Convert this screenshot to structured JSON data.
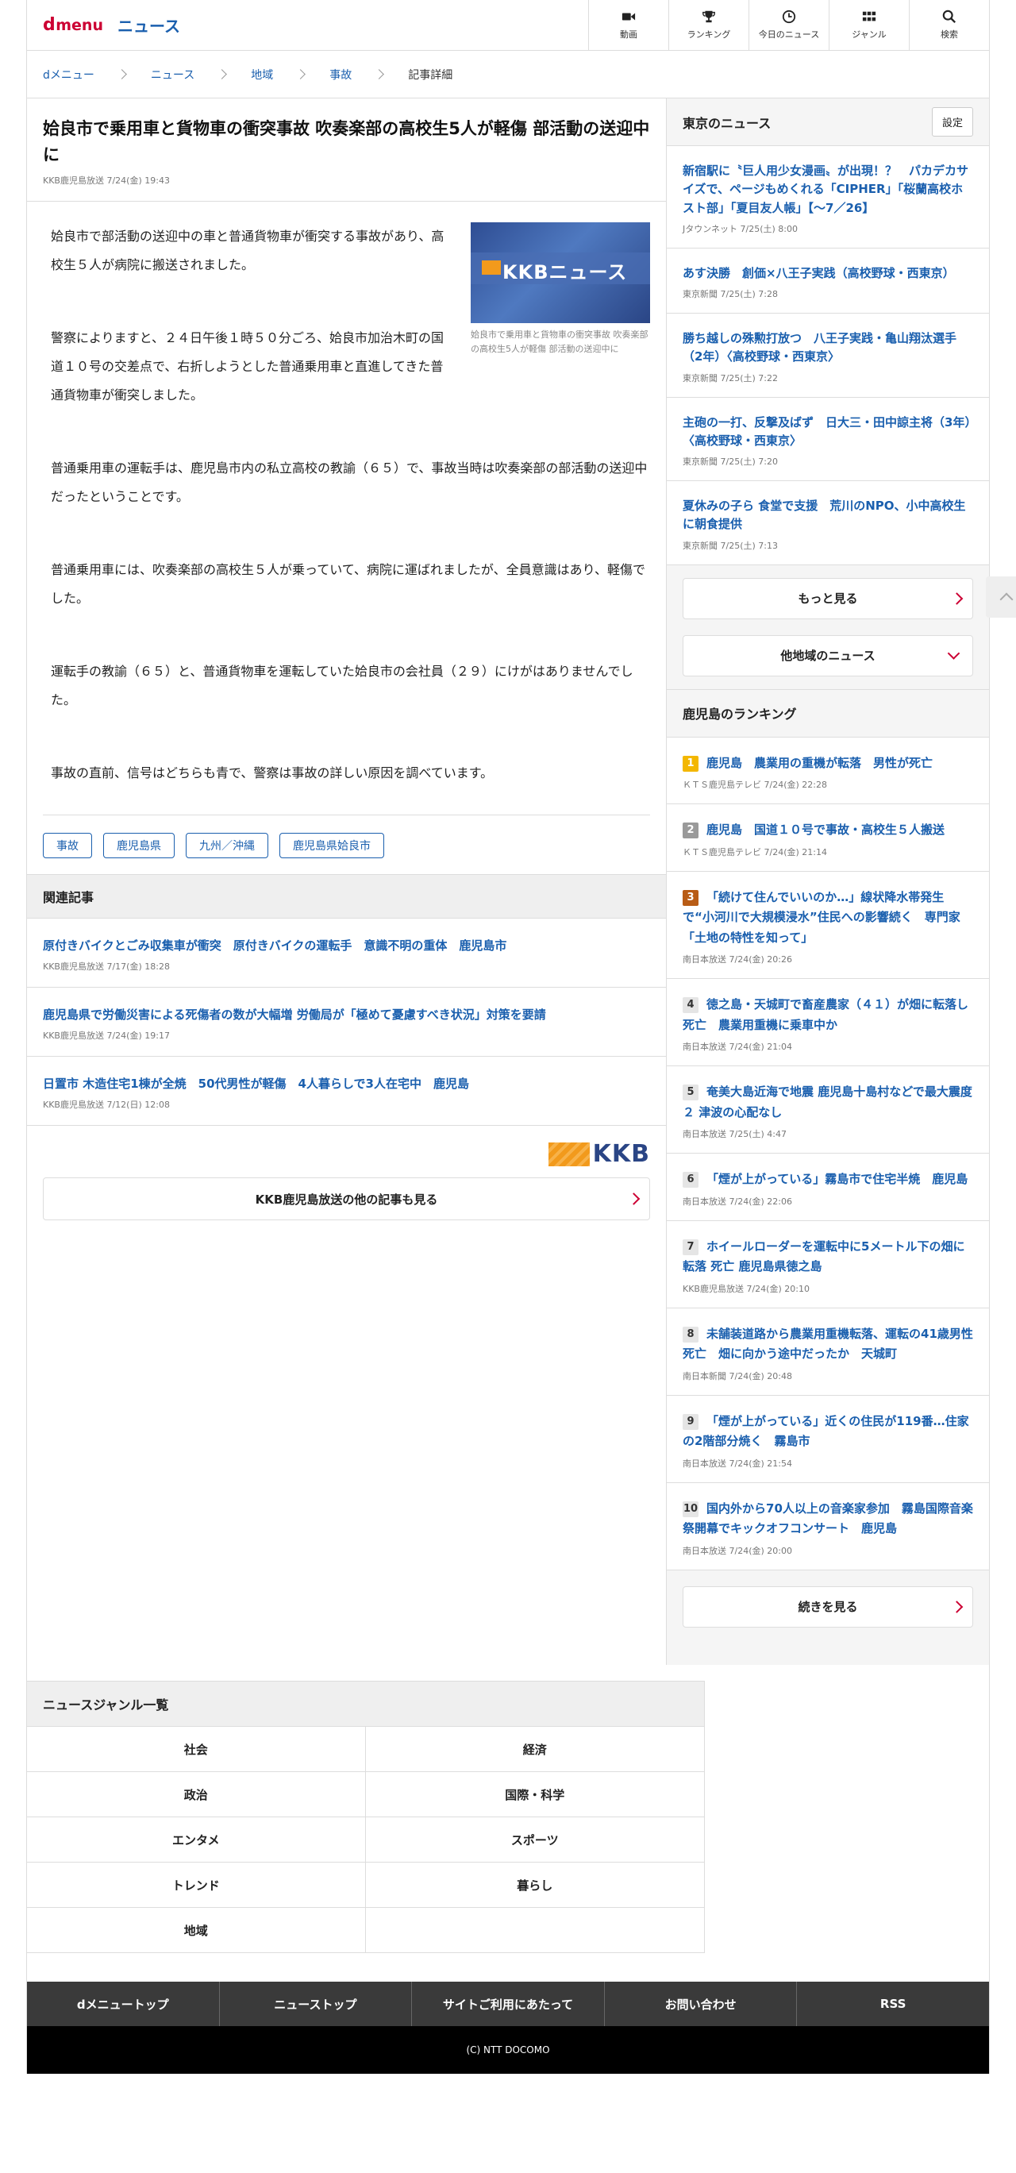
{
  "header": {
    "logo_d": "d",
    "logo_menu": "menu",
    "logo_news": "ニュース",
    "nav": [
      {
        "label": "動画",
        "icon": "video-icon"
      },
      {
        "label": "ランキング",
        "icon": "trophy-icon"
      },
      {
        "label": "今日のニュース",
        "icon": "clock-icon"
      },
      {
        "label": "ジャンル",
        "icon": "grid-icon"
      },
      {
        "label": "検索",
        "icon": "search-icon"
      }
    ]
  },
  "breadcrumb": [
    "dメニュー",
    "ニュース",
    "地域",
    "事故",
    "記事詳細"
  ],
  "article": {
    "title": "姶良市で乗用車と貨物車の衝突事故 吹奏楽部の高校生5人が軽傷 部活動の送迎中に",
    "meta": "KKB鹿児島放送 7/24(金) 19:43",
    "photo_logo": "KKBニュース",
    "photo_caption": "姶良市で乗用車と貨物車の衝突事故 吹奏楽部の高校生5人が軽傷 部活動の送迎中に",
    "paragraphs": [
      "姶良市で部活動の送迎中の車と普通貨物車が衝突する事故があり、高校生５人が病院に搬送されました。",
      "警察によりますと、２４日午後１時５０分ごろ、姶良市加治木町の国道１０号の交差点で、右折しようとした普通乗用車と直進してきた普通貨物車が衝突しました。",
      "普通乗用車の運転手は、鹿児島市内の私立高校の教諭（６５）で、事故当時は吹奏楽部の部活動の送迎中だったということです。",
      "普通乗用車には、吹奏楽部の高校生５人が乗っていて、病院に運ばれましたが、全員意識はあり、軽傷でした。",
      "運転手の教諭（６５）と、普通貨物車を運転していた姶良市の会社員（２９）にけがはありませんでした。",
      "事故の直前、信号はどちらも青で、警察は事故の詳しい原因を調べています。"
    ],
    "tags": [
      "事故",
      "鹿児島県",
      "九州／沖縄",
      "鹿児島県姶良市"
    ]
  },
  "related": {
    "heading": "関連記事",
    "items": [
      {
        "title": "原付きバイクとごみ収集車が衝突　原付きバイクの運転手　意識不明の重体　鹿児島市",
        "meta": "KKB鹿児島放送 7/17(金) 18:28"
      },
      {
        "title": "鹿児島県で労働災害による死傷者の数が大幅増 労働局が「極めて憂慮すべき状況」対策を要請",
        "meta": "KKB鹿児島放送 7/24(金) 19:17"
      },
      {
        "title": "日置市 木造住宅1棟が全焼　50代男性が軽傷　4人暮らしで3人在宅中　鹿児島",
        "meta": "KKB鹿児島放送 7/12(日) 12:08"
      }
    ],
    "provider_logo": "KKB",
    "more_label": "KKB鹿児島放送の他の記事も見る"
  },
  "tokyo": {
    "heading": "東京のニュース",
    "settings_label": "設定",
    "items": [
      {
        "title": "新宿駅に〝巨人用少女漫画〟が出現！？　パカデカサイズで、ページもめくれる「CIPHER」「桜蘭高校ホスト部」「夏目友人帳」【〜7／26】",
        "meta": "Jタウンネット 7/25(土) 8:00"
      },
      {
        "title": "あす決勝　創価×八王子実践（高校野球・西東京）",
        "meta": "東京新聞 7/25(土) 7:28"
      },
      {
        "title": "勝ち越しの殊勲打放つ　八王子実践・亀山翔汰選手（2年）〈高校野球・西東京〉",
        "meta": "東京新聞 7/25(土) 7:22"
      },
      {
        "title": "主砲の一打、反撃及ばず　日大三・田中諒主将（3年）〈高校野球・西東京〉",
        "meta": "東京新聞 7/25(土) 7:20"
      },
      {
        "title": "夏休みの子ら 食堂で支援　荒川のNPO、小中高校生に朝食提供",
        "meta": "東京新聞 7/25(土) 7:13"
      }
    ],
    "more_label": "もっと見る",
    "other_label": "他地域のニュース"
  },
  "ranking": {
    "heading": "鹿児島のランキング",
    "items": [
      {
        "num": "1",
        "title": "鹿児島　農業用の重機が転落　男性が死亡",
        "meta": "ＫＴＳ鹿児島テレビ 7/24(金) 22:28"
      },
      {
        "num": "2",
        "title": "鹿児島　国道１０号で事故・高校生５人搬送",
        "meta": "ＫＴＳ鹿児島テレビ 7/24(金) 21:14"
      },
      {
        "num": "3",
        "title": "「続けて住んでいいのか…」線状降水帯発生で“小河川で大規模浸水”住民への影響続く　専門家「土地の特性を知って」",
        "meta": "南日本放送 7/24(金) 20:26"
      },
      {
        "num": "4",
        "title": "徳之島・天城町で畜産農家（４１）が畑に転落し死亡　農業用重機に乗車中か",
        "meta": "南日本放送 7/24(金) 21:04"
      },
      {
        "num": "5",
        "title": "奄美大島近海で地震 鹿児島十島村などで最大震度２ 津波の心配なし",
        "meta": "南日本放送 7/25(土) 4:47"
      },
      {
        "num": "6",
        "title": "「煙が上がっている」霧島市で住宅半焼　鹿児島",
        "meta": "南日本放送 7/24(金) 22:06"
      },
      {
        "num": "7",
        "title": "ホイールローダーを運転中に5メートル下の畑に転落 死亡 鹿児島県徳之島",
        "meta": "KKB鹿児島放送 7/24(金) 20:10"
      },
      {
        "num": "8",
        "title": "未舗装道路から農業用重機転落、運転の41歳男性死亡　畑に向かう途中だったか　天城町",
        "meta": "南日本新聞 7/24(金) 20:48"
      },
      {
        "num": "9",
        "title": "「煙が上がっている」近くの住民が119番…住家の2階部分焼く　霧島市",
        "meta": "南日本放送 7/24(金) 21:54"
      },
      {
        "num": "10",
        "title": "国内外から70人以上の音楽家参加　霧島国際音楽祭開幕でキックオフコンサート　鹿児島",
        "meta": "南日本放送 7/24(金) 20:00"
      }
    ],
    "more_label": "続きを見る"
  },
  "genre": {
    "heading": "ニュースジャンル一覧",
    "items": [
      "社会",
      "経済",
      "政治",
      "国際・科学",
      "エンタメ",
      "スポーツ",
      "トレンド",
      "暮らし",
      "地域",
      ""
    ]
  },
  "footer": {
    "links": [
      "dメニュートップ",
      "ニューストップ",
      "サイトご利用にあたって",
      "お問い合わせ",
      "RSS"
    ],
    "copyright": "(C) NTT DOCOMO"
  },
  "colors": {
    "brand": "#cc0033",
    "link": "#1a5fae",
    "rank1": "#f3b700",
    "rank2": "#9a9a9a",
    "rank3": "#b85c16"
  }
}
